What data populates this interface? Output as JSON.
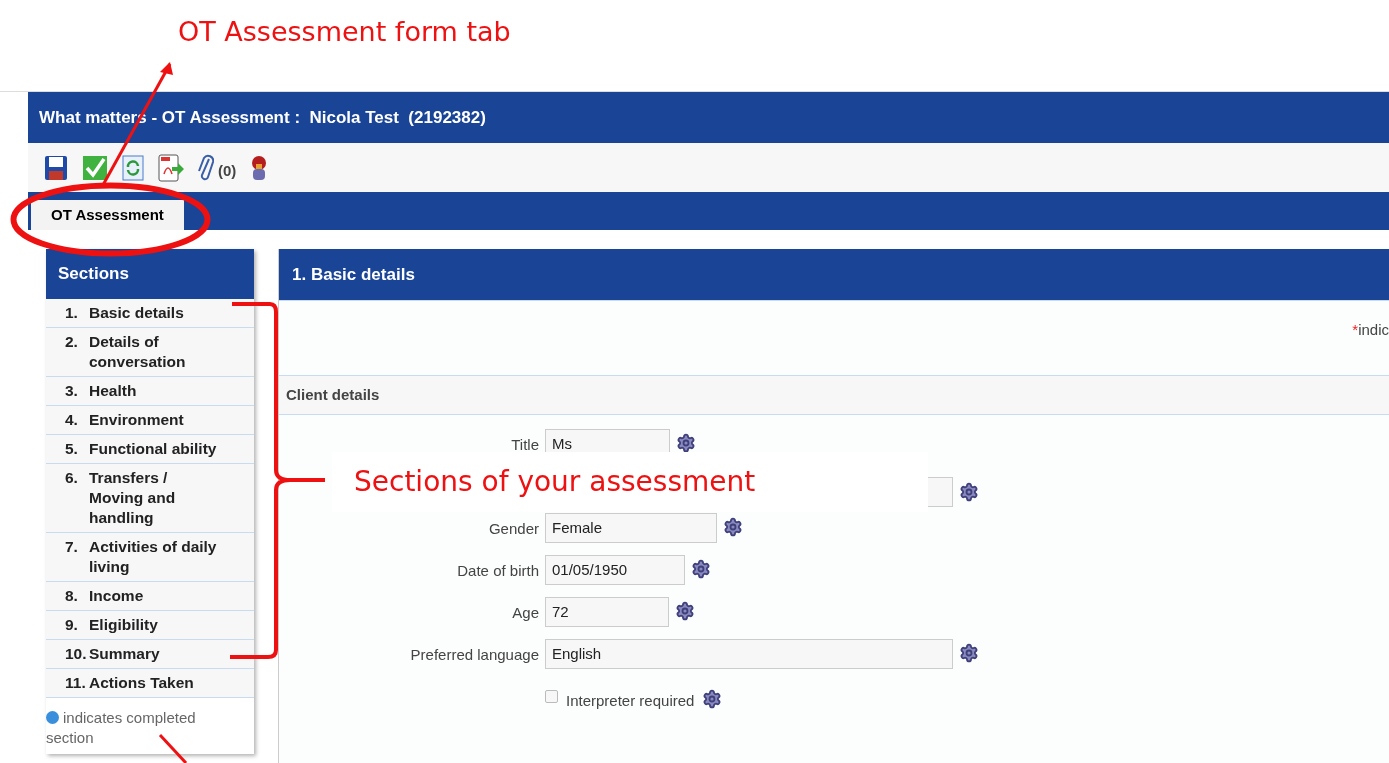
{
  "annotations": {
    "tab_label": "OT Assessment form tab",
    "sections_label": "Sections of your assessment"
  },
  "window": {
    "title": "What matters - OT Assessment :  Nicola Test  (2192382)"
  },
  "toolbar": {
    "attachments_count": "(0)"
  },
  "tabs": [
    {
      "label": "OT Assessment",
      "selected": true
    }
  ],
  "sections": {
    "title": "Sections",
    "items": [
      {
        "number": "1.",
        "label": "Basic details"
      },
      {
        "number": "2.",
        "label": "Details of conversation"
      },
      {
        "number": "3.",
        "label": "Health"
      },
      {
        "number": "4.",
        "label": "Environment"
      },
      {
        "number": "5.",
        "label": "Functional ability"
      },
      {
        "number": "6.",
        "label": "Transfers / Moving and handling"
      },
      {
        "number": "7.",
        "label": "Activities of daily living"
      },
      {
        "number": "8.",
        "label": "Income"
      },
      {
        "number": "9.",
        "label": "Eligibility"
      },
      {
        "number": "10.",
        "label": "Summary"
      },
      {
        "number": "11.",
        "label": "Actions Taken"
      }
    ],
    "legend": "indicates completed section"
  },
  "main": {
    "title": "1. Basic details",
    "required_mark": "*",
    "required_note": "indic",
    "group": "Client details",
    "fields": [
      {
        "kind": "text",
        "label": "Title",
        "value": "Ms"
      },
      {
        "kind": "covered"
      },
      {
        "kind": "text",
        "label": "Gender",
        "value": "Female"
      },
      {
        "kind": "text",
        "label": "Date of birth",
        "value": "01/05/1950"
      },
      {
        "kind": "text",
        "label": "Age",
        "value": "72"
      },
      {
        "kind": "text",
        "label": "Preferred language",
        "value": "English"
      },
      {
        "kind": "checkbox",
        "label": "Interpreter required",
        "checked": false
      }
    ]
  }
}
